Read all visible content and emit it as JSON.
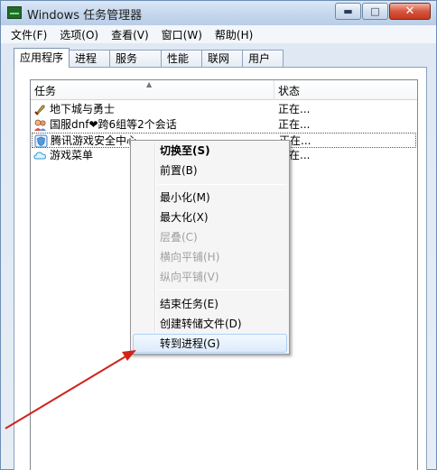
{
  "window": {
    "title": "Windows 任务管理器"
  },
  "titlebar_buttons": {
    "minimize": "▬",
    "maximize": "□",
    "close": "✕"
  },
  "menubar": {
    "items": [
      {
        "label": "文件(F)"
      },
      {
        "label": "选项(O)"
      },
      {
        "label": "查看(V)"
      },
      {
        "label": "窗口(W)"
      },
      {
        "label": "帮助(H)"
      }
    ]
  },
  "tabs": [
    {
      "label": "应用程序",
      "active": true
    },
    {
      "label": "进程"
    },
    {
      "label": "服务"
    },
    {
      "label": "性能"
    },
    {
      "label": "联网"
    },
    {
      "label": "用户"
    }
  ],
  "list": {
    "columns": {
      "task": "任务",
      "status": "状态"
    },
    "rows": [
      {
        "name": "地下城与勇士",
        "status": "正在...",
        "icon": "sword-icon"
      },
      {
        "name": "国服dnf❤跨6组等2个会话",
        "status": "正在...",
        "icon": "chat-contacts-icon"
      },
      {
        "name": "腾讯游戏安全中心",
        "status": "正在...",
        "icon": "shield-icon",
        "selected": true
      },
      {
        "name": "游戏菜单",
        "status": "正在...",
        "icon": "cloud-icon"
      }
    ]
  },
  "context_menu": {
    "items": [
      {
        "label": "切换至(S)",
        "bold": true
      },
      {
        "label": "前置(B)"
      },
      {
        "label": "最小化(M)"
      },
      {
        "label": "最大化(X)"
      },
      {
        "label": "层叠(C)",
        "disabled": true
      },
      {
        "label": "横向平铺(H)",
        "disabled": true
      },
      {
        "label": "纵向平铺(V)",
        "disabled": true
      },
      {
        "label": "结束任务(E)"
      },
      {
        "label": "创建转储文件(D)"
      },
      {
        "label": "转到进程(G)",
        "highlighted": true
      }
    ]
  },
  "colors": {
    "accent": "#aecff7",
    "annotation_arrow": "#d0241b",
    "disabled_text": "#a0a0a0"
  }
}
